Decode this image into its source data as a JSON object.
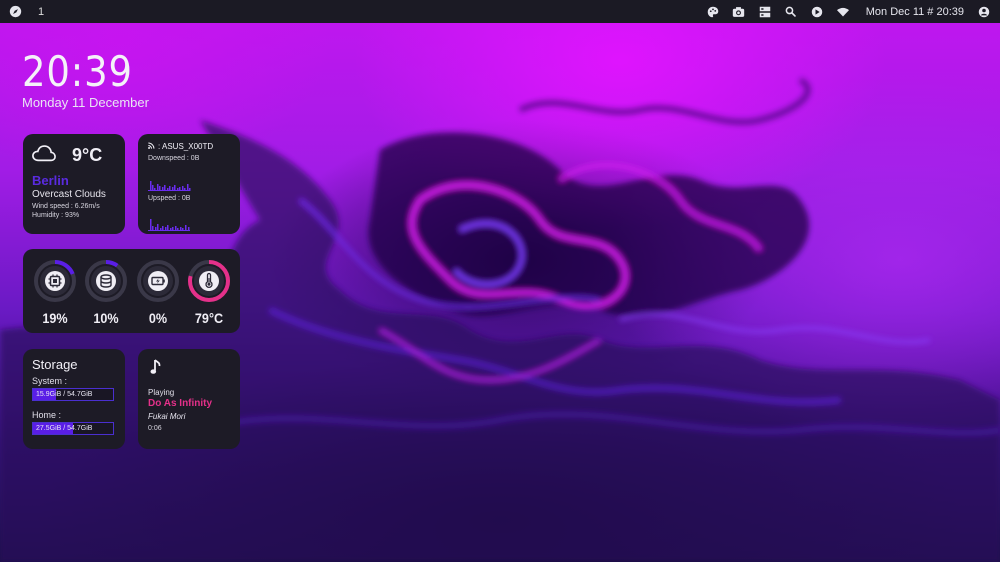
{
  "topbar": {
    "workspace": "1",
    "datetime": "Mon Dec 11 # 20:39",
    "icons": [
      "compass-icon",
      "palette-icon",
      "camera-icon",
      "panel-icon",
      "search-icon",
      "play-icon",
      "wifi-icon",
      "user-icon"
    ]
  },
  "desktop_clock": {
    "time": "20:39",
    "date": "Monday 11 December"
  },
  "weather": {
    "temperature": "9°C",
    "city": "Berlin",
    "condition": "Overcast Clouds",
    "wind": "Wind speed : 6.26m/s",
    "humidity": "Humidity : 93%",
    "icon": "cloud-icon"
  },
  "network": {
    "ssid": ": ASUS_X00TD",
    "downspeed": "Downspeed : 0B",
    "upspeed": "Upspeed : 0B",
    "icon": "rss-icon"
  },
  "gauges": [
    {
      "name": "cpu",
      "value": "19%",
      "fraction": 0.19,
      "icon": "cpu-icon"
    },
    {
      "name": "memory",
      "value": "10%",
      "fraction": 0.1,
      "icon": "database-icon"
    },
    {
      "name": "battery",
      "value": "0%",
      "fraction": 0.0,
      "icon": "battery-icon"
    },
    {
      "name": "temperature",
      "value": "79°C",
      "fraction": 0.79,
      "icon": "thermometer-icon"
    }
  ],
  "storage": {
    "title": "Storage",
    "system_label": "System :",
    "system_value": "15.9GiB / 54.7GiB",
    "system_fraction": 0.29,
    "home_label": "Home :",
    "home_value": "27.5GiB / 54.7GiB",
    "home_fraction": 0.5
  },
  "music": {
    "status": "Playing",
    "title": "Do As Infinity",
    "artist": "Fukai Mori",
    "time": "0:06",
    "icon": "music-note-icon"
  },
  "colors": {
    "accent_purple": "#5a1ee6",
    "accent_pink": "#e5308a",
    "card_bg": "#1d1b26",
    "topbar_bg": "#1b1a24"
  }
}
